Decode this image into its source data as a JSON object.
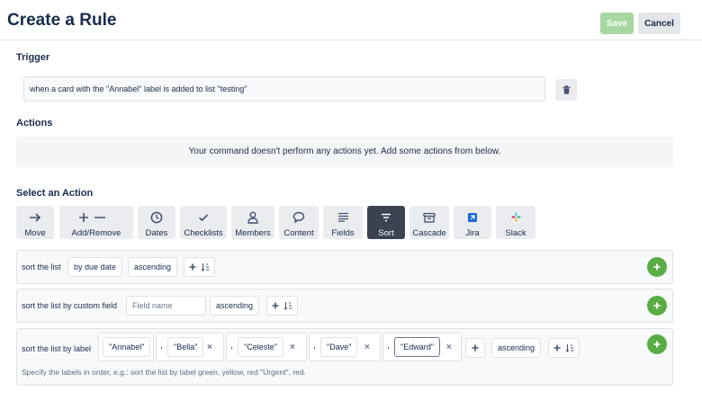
{
  "header": {
    "title": "Create a Rule",
    "save_label": "Save",
    "cancel_label": "Cancel"
  },
  "trigger": {
    "heading": "Trigger",
    "text": "when a card with the \"Annabel\" label is added to list \"testing\""
  },
  "actions": {
    "heading": "Actions",
    "empty_message": "Your command doesn't perform any actions yet. Add some actions from below."
  },
  "select_action": {
    "heading": "Select an Action",
    "tabs": [
      {
        "label": "Move",
        "icon": "arrow-right-icon"
      },
      {
        "label": "Add/Remove",
        "icon": "plus-minus-icon"
      },
      {
        "label": "Dates",
        "icon": "clock-icon"
      },
      {
        "label": "Checklists",
        "icon": "check-icon"
      },
      {
        "label": "Members",
        "icon": "person-icon"
      },
      {
        "label": "Content",
        "icon": "speech-bubble-icon"
      },
      {
        "label": "Fields",
        "icon": "lines-icon"
      },
      {
        "label": "Sort",
        "icon": "filter-icon",
        "active": true
      },
      {
        "label": "Cascade",
        "icon": "archive-icon"
      },
      {
        "label": "Jira",
        "icon": "jira-logo-icon"
      },
      {
        "label": "Slack",
        "icon": "slack-logo-icon"
      }
    ]
  },
  "rows": {
    "sort_list": {
      "label": "sort the list",
      "by": "by due date",
      "order": "ascending"
    },
    "sort_custom": {
      "label": "sort the list by custom field",
      "field_placeholder": "Field name",
      "order": "ascending"
    },
    "sort_label": {
      "label": "sort the list by label",
      "first": "\"Annabel\"",
      "labels": [
        "\"Bella\"",
        "\"Celeste\"",
        "\"Dave\"",
        "\"Edward\""
      ],
      "comma": ",",
      "remove": "×",
      "order": "ascending",
      "hint": "Specify the labels in order, e.g.: sort the list by label green, yellow, red \"Urgent\", red."
    }
  },
  "colors": {
    "accent_green": "#5aac44",
    "save_disabled": "#a7d8a2",
    "active_tab": "#3b4252"
  }
}
